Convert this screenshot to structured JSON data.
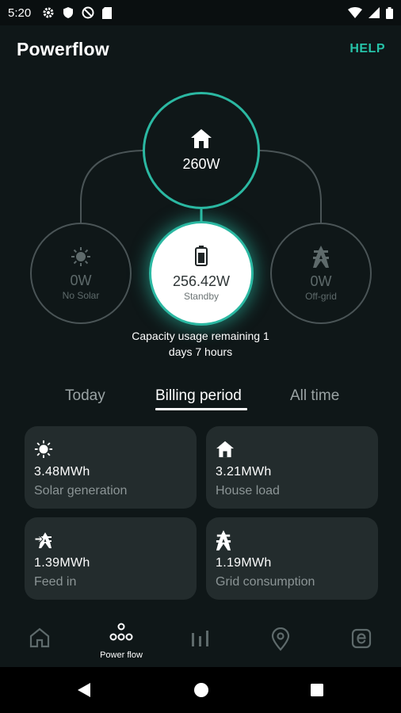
{
  "status_bar": {
    "time": "5:20"
  },
  "header": {
    "title": "Powerflow",
    "help": "HELP"
  },
  "powerflow": {
    "house": {
      "value": "260W",
      "icon": "house-icon"
    },
    "solar": {
      "value": "0W",
      "status": "No Solar",
      "icon": "sun-icon"
    },
    "battery": {
      "value": "256.42W",
      "status": "Standby",
      "icon": "battery-icon"
    },
    "grid": {
      "value": "0W",
      "status": "Off-grid",
      "icon": "pylon-icon"
    },
    "capacity_text": "Capacity usage remaining 1 days 7 hours"
  },
  "tabs": [
    {
      "label": "Today"
    },
    {
      "label": "Billing period",
      "selected": true
    },
    {
      "label": "All time"
    }
  ],
  "cards": [
    {
      "value": "3.48MWh",
      "label": "Solar generation",
      "icon": "sun-icon"
    },
    {
      "value": "3.21MWh",
      "label": "House load",
      "icon": "house-icon"
    },
    {
      "value": "1.39MWh",
      "label": "Feed in",
      "icon": "feed-in-icon"
    },
    {
      "value": "1.19MWh",
      "label": "Grid consumption",
      "icon": "pylon-icon"
    }
  ],
  "bottom_nav": {
    "items": [
      {
        "icon": "home-icon"
      },
      {
        "icon": "powerflow-icon",
        "label": "Power flow",
        "selected": true
      },
      {
        "icon": "stats-icon"
      },
      {
        "icon": "location-icon"
      },
      {
        "icon": "energy-icon"
      }
    ]
  },
  "colors": {
    "background": "#0f1718",
    "accent": "#2bb8a2",
    "card": "#232c2d"
  }
}
